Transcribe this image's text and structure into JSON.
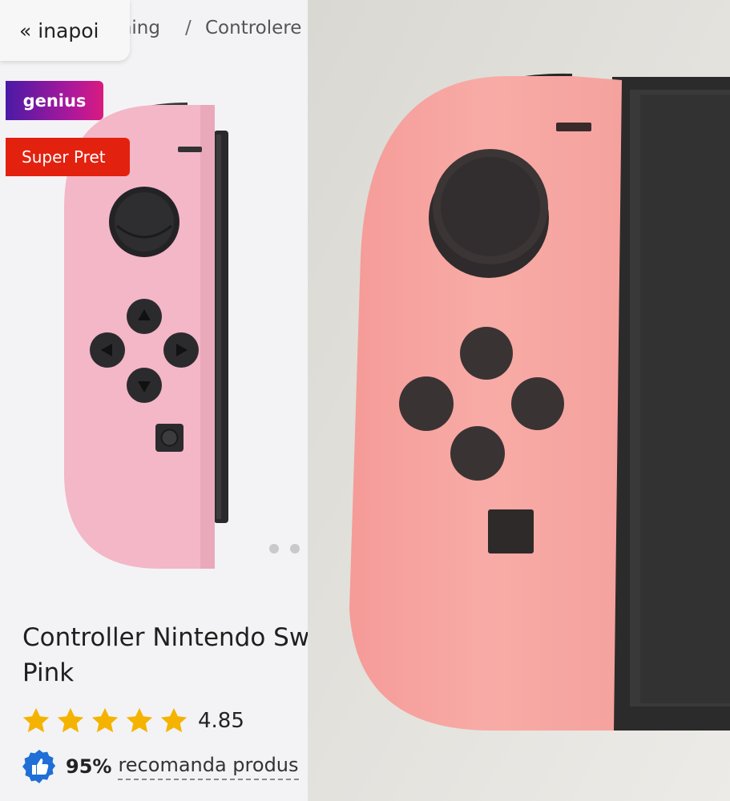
{
  "breadcrumb": {
    "back_label": "« inapoi",
    "items": [
      "ming",
      "Controlere"
    ],
    "separator": "/"
  },
  "badges": {
    "genius": "genius",
    "super_pret": "Super Pret"
  },
  "product": {
    "title_line1": "Controller Nintendo Sw",
    "title_line2": "Pink",
    "rating_value": "4.85",
    "stars_filled": 5,
    "recommend_percent": "95%",
    "recommend_text": "recomanda produs"
  },
  "colors": {
    "accent_red": "#e3210f",
    "star_gold": "#f5b301",
    "recommend_blue": "#1f6fd6",
    "joycon_pink": "#f2b5c6",
    "photo_pink": "#f7a6a3"
  },
  "icons": {
    "rating": "star-icon",
    "recommend": "thumbs-up-badge-icon"
  }
}
